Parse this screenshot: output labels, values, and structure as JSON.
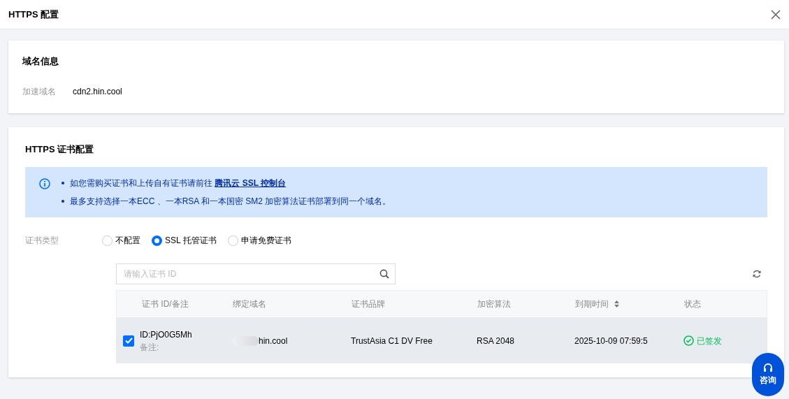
{
  "dialog": {
    "title": "HTTPS 配置"
  },
  "domain_card": {
    "title": "域名信息",
    "label": "加速域名",
    "value": "cdn2.hin.cool"
  },
  "https_card": {
    "title": "HTTPS 证书配置",
    "notices": [
      {
        "text": "如您需购买证书和上传自有证书请前往 ",
        "link": "腾讯云 SSL 控制台"
      },
      {
        "text": "最多支持选择一本ECC 、一本RSA 和一本国密 SM2 加密算法证书部署到同一个域名。"
      }
    ],
    "cert_type": {
      "label": "证书类型",
      "options": [
        {
          "label": "不配置",
          "selected": false
        },
        {
          "label": "SSL 托管证书",
          "selected": true
        },
        {
          "label": "申请免费证书",
          "selected": false
        }
      ]
    },
    "search": {
      "placeholder": "请输入证书 ID"
    },
    "table": {
      "columns": [
        {
          "label": "证书 ID/备注"
        },
        {
          "label": "绑定域名"
        },
        {
          "label": "证书品牌"
        },
        {
          "label": "加密算法"
        },
        {
          "label": "到期时间",
          "sortable": true
        },
        {
          "label": "状态"
        }
      ],
      "rows": [
        {
          "selected": true,
          "id": "ID:PjO0G5Mh",
          "note": "备注:",
          "domain": "hin.cool",
          "domain_redacted": true,
          "brand": "TrustAsia C1 DV Free",
          "algorithm": "RSA 2048",
          "expires": "2025-10-09 07:59:5",
          "status": "已签发"
        }
      ]
    }
  },
  "consult_button": {
    "label": "咨询"
  }
}
